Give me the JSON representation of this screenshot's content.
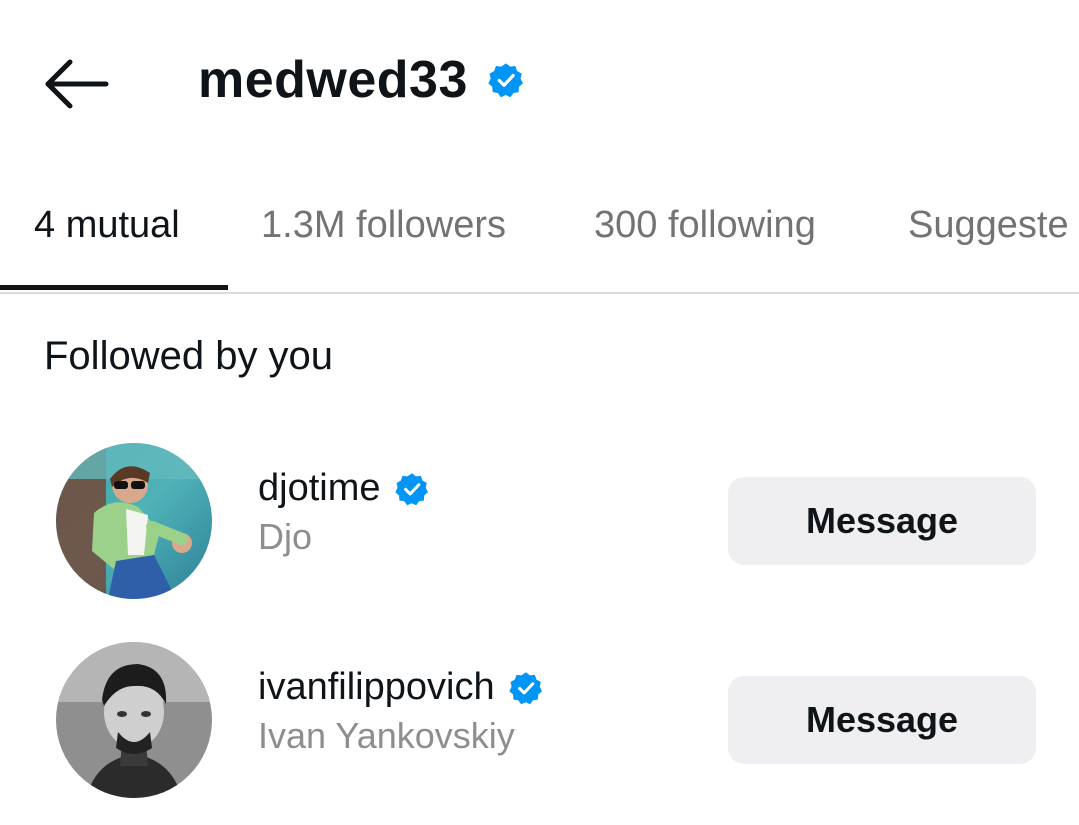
{
  "header": {
    "title": "medwed33",
    "back_icon": "arrow-left-icon",
    "verified_icon": "verified-badge-icon"
  },
  "tabs": [
    {
      "label": "4 mutual",
      "active": true
    },
    {
      "label": "1.3M followers",
      "active": false
    },
    {
      "label": "300 following",
      "active": false
    },
    {
      "label": "Suggeste",
      "active": false
    }
  ],
  "section": {
    "title": "Followed by you"
  },
  "users": [
    {
      "username": "djotime",
      "full_name": "Djo",
      "verified": true,
      "button_label": "Message"
    },
    {
      "username": "ivanfilippovich",
      "full_name": "Ivan Yankovskiy",
      "verified": true,
      "button_label": "Message"
    }
  ],
  "colors": {
    "verified_blue": "#0095f6",
    "button_bg": "#efeff2",
    "secondary_text": "#8e8e8e",
    "tab_inactive": "#737373"
  }
}
